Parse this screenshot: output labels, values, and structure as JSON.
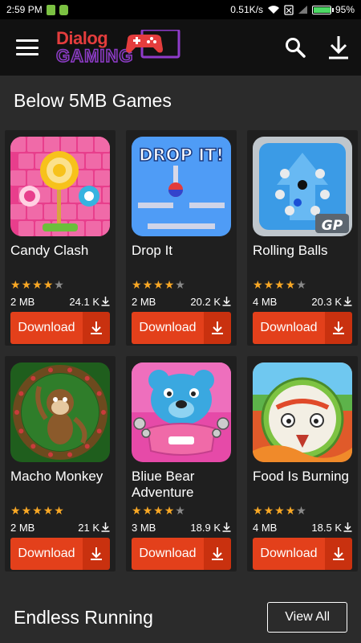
{
  "status_bar": {
    "time": "2:59 PM",
    "network_speed": "0.51K/s",
    "battery_percent": "95%",
    "battery_level": 0.95
  },
  "app": {
    "logo_line1": "Dialog",
    "logo_line2": "GAMING"
  },
  "section1": {
    "title": "Below 5MB Games"
  },
  "games": [
    {
      "name": "Candy Clash",
      "rating": 4,
      "size": "2 MB",
      "downloads": "24.1 K",
      "button": "Download",
      "thumb": "candy-clash-thumbnail"
    },
    {
      "name": "Drop It",
      "rating": 4,
      "size": "2 MB",
      "downloads": "20.2 K",
      "button": "Download",
      "thumb": "drop-it-thumbnail",
      "thumb_text": "DROP IT!"
    },
    {
      "name": "Rolling Balls",
      "rating": 4,
      "size": "4 MB",
      "downloads": "20.3 K",
      "button": "Download",
      "thumb": "rolling-balls-thumbnail",
      "thumb_text": "GP"
    },
    {
      "name": "Macho Monkey",
      "rating": 5,
      "size": "2 MB",
      "downloads": "21 K",
      "button": "Download",
      "thumb": "macho-monkey-thumbnail"
    },
    {
      "name": "Bliue Bear Adventure",
      "rating": 4,
      "size": "3 MB",
      "downloads": "18.9 K",
      "button": "Download",
      "thumb": "blue-bear-thumbnail"
    },
    {
      "name": "Food Is Burning",
      "rating": 4,
      "size": "4 MB",
      "downloads": "18.5 K",
      "button": "Download",
      "thumb": "food-is-burning-thumbnail"
    }
  ],
  "section2": {
    "title": "Endless Running",
    "view_all_label": "View All"
  },
  "colors": {
    "accent": "#e3401b",
    "accent_dark": "#c9310f",
    "star": "#f9a825",
    "background": "#2b2b2b",
    "card": "#1f1f1f"
  }
}
